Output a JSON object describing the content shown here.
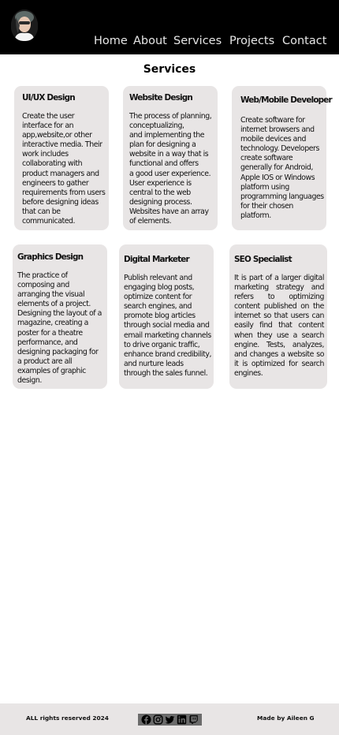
{
  "nav": {
    "items": [
      {
        "label": "Home"
      },
      {
        "label": "About"
      },
      {
        "label": "Services"
      },
      {
        "label": "Projects"
      },
      {
        "label": "Contact"
      }
    ]
  },
  "page_title": "Services",
  "services": [
    {
      "title": "UI/UX Design",
      "body": "Create the user\ninterface for an\napp,website,or other\ninteractive media. Their\nwork includes\ncollaborating with\nproduct managers and\nengineers to gather\nrequirements from users\nbefore designing ideas\nthat can be\ncommunicated."
    },
    {
      "title": "Website Design",
      "body": "The process of planning,\nconceptualizing,\nand implementing the\nplan for designing a\nwebsite in a way that is\nfunctional and offers\n a good user experience.\nUser experience is\n central to the web\ndesigning process.\nWebsites have an array\nof elements."
    },
    {
      "title": "Web/Mobile Developer",
      "body": "Create software for\ninternet browsers and\nmobile devices and\ntechnology. Developers\ncreate software\ngenerally for Android,\nApple IOS or Windows\nplatform using\nprogramming languages\nfor their chosen\nplatform."
    },
    {
      "title": "Graphics Design",
      "body": "The practice of\ncomposing and\narranging the visual\nelements of a project.\nDesigning the layout of a\nmagazine, creating a\nposter for a theatre\nperformance, and\ndesigning packaging for\na product are all\nexamples of graphic\ndesign."
    },
    {
      "title": "Digital Marketer",
      "body": "Publish relevant and\nengaging blog posts,\noptimize content for\nsearch engines, and\npromote blog articles\nthrough social media and\nemail marketing channels\nto drive organic traffic,\nenhance brand credibility,\nand nurture leads\nthrough the sales funnel."
    },
    {
      "title": "SEO Specialist",
      "body": "It is part of a larger digital marketing strategy and refers to optimizing content published on the internet so that users can easily find that content when they use a search engine. Tests, analyzes, and changes a website so it is optimized for search engines."
    }
  ],
  "footer": {
    "copyright": "ALL rights reserved 2024",
    "made_by": "Made by Aileen G",
    "social_icons": [
      "facebook-icon",
      "instagram-icon",
      "twitter-icon",
      "linkedin-icon",
      "twitch-icon"
    ]
  },
  "colors": {
    "header_bg": "#000000",
    "nav_text": "#e6e6e6",
    "card_bg": "#e8e5e5",
    "footer_bg": "#e8e5e5",
    "social_bar_bg": "#6b6b6b"
  }
}
